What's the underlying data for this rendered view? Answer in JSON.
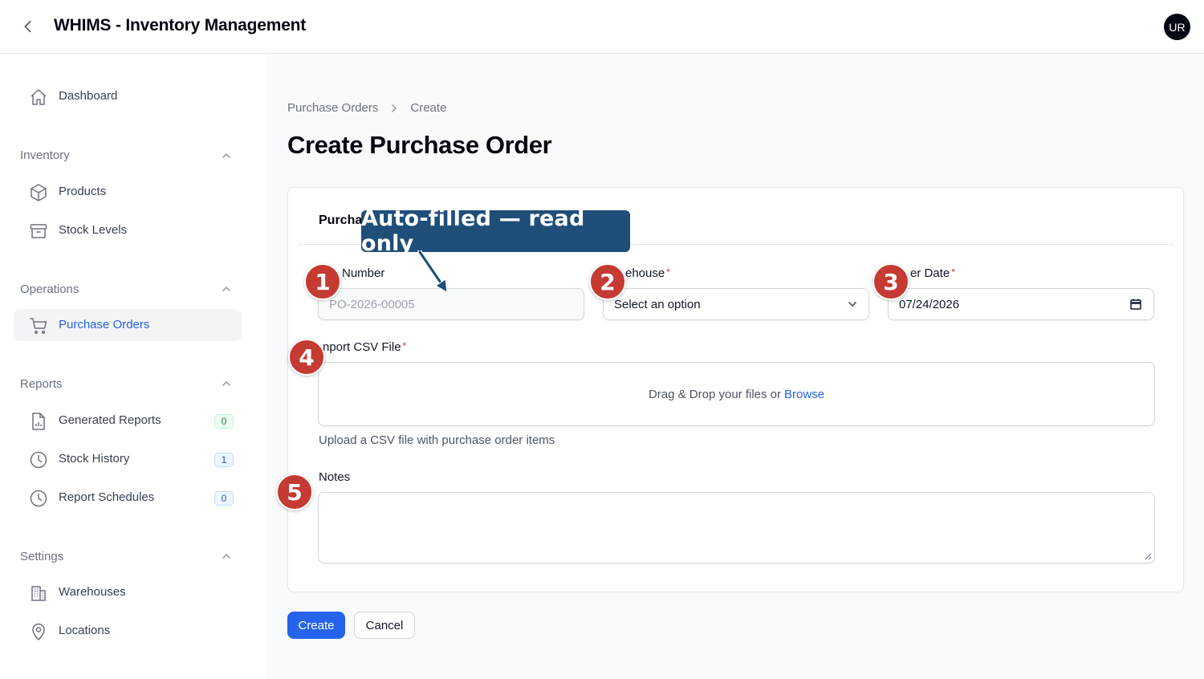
{
  "header": {
    "app_title": "WHIMS - Inventory Management",
    "avatar_initials": "UR"
  },
  "sidebar": {
    "dashboard": "Dashboard",
    "groups": {
      "inventory": {
        "label": "Inventory",
        "items": [
          "Products",
          "Stock Levels"
        ]
      },
      "operations": {
        "label": "Operations",
        "items": [
          "Purchase Orders"
        ]
      },
      "reports": {
        "label": "Reports",
        "items": [
          {
            "label": "Generated Reports",
            "badge": "0"
          },
          {
            "label": "Stock History",
            "badge": "1"
          },
          {
            "label": "Report Schedules",
            "badge": "0"
          }
        ]
      },
      "settings": {
        "label": "Settings",
        "items": [
          "Warehouses",
          "Locations"
        ]
      }
    },
    "active_item": "Purchase Orders"
  },
  "breadcrumb": {
    "parent": "Purchase Orders",
    "current": "Create"
  },
  "page_title": "Create Purchase Order",
  "form": {
    "section_title": "Purcha",
    "po_number": {
      "label": "Number",
      "value": "PO-2026-00005"
    },
    "warehouse": {
      "label": "ehouse",
      "value": "Select an option"
    },
    "order_date": {
      "label": "er Date",
      "value": "07/24/2026"
    },
    "csv": {
      "label": "nport CSV File",
      "dropzone_text": "Drag & Drop your files or",
      "browse_label": "Browse",
      "helper": "Upload a CSV file with purchase order items"
    },
    "notes": {
      "label": "Notes",
      "value": ""
    }
  },
  "actions": {
    "create": "Create",
    "cancel": "Cancel"
  },
  "annotations": {
    "callout": "Auto-filled — read only",
    "markers": [
      "1",
      "2",
      "3",
      "4",
      "5"
    ]
  },
  "colors": {
    "accent": "#2563eb",
    "required": "#dc2626",
    "callout_bg": "#1f4e79",
    "marker_bg": "#c53a32"
  }
}
